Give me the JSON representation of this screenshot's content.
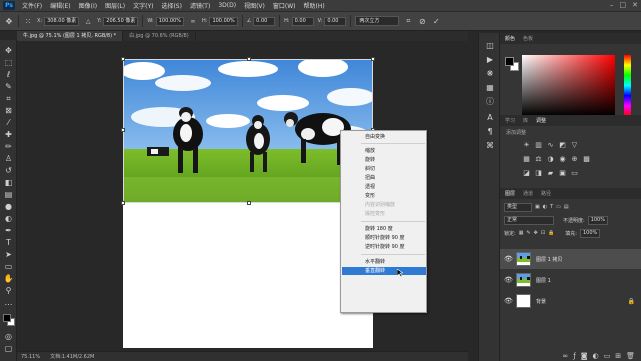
{
  "app": {
    "logo": "Ps",
    "menu": [
      "文件(F)",
      "编辑(E)",
      "图像(I)",
      "图层(L)",
      "文字(Y)",
      "选择(S)",
      "滤镜(T)",
      "3D(D)",
      "视图(V)",
      "窗口(W)",
      "帮助(H)"
    ]
  },
  "options": {
    "x_label": "X:",
    "x_value": "308.00 像素",
    "y_label": "Y:",
    "y_value": "206.50 像素",
    "w_label": "W:",
    "w_value": "100.00%",
    "h_label": "H:",
    "h_value": "100.00%",
    "angle_label": "∠",
    "angle_value": "0.00",
    "hskew_label": "H:",
    "hskew_value": "0.00",
    "vskew_label": "V:",
    "vskew_value": "0.00",
    "interp_value": "两次立方"
  },
  "tabs": [
    {
      "label": "牛.jpg @ 75.1% (图层 1 拷贝, RGB/8) *"
    },
    {
      "label": "白.jpg @ 70.6% (RGB/8)"
    }
  ],
  "context_menu": {
    "items": [
      {
        "label": "自由变换",
        "state": "normal"
      },
      {
        "label": "缩放",
        "state": "normal"
      },
      {
        "label": "旋转",
        "state": "normal"
      },
      {
        "label": "斜切",
        "state": "normal"
      },
      {
        "label": "扭曲",
        "state": "normal"
      },
      {
        "label": "透视",
        "state": "normal"
      },
      {
        "label": "变形",
        "state": "normal"
      },
      {
        "label": "内容识别缩放",
        "state": "disabled"
      },
      {
        "label": "操控变形",
        "state": "disabled"
      },
      {
        "label": "旋转 180 度",
        "state": "normal"
      },
      {
        "label": "顺时针旋转 90 度",
        "state": "normal"
      },
      {
        "label": "逆时针旋转 90 度",
        "state": "normal"
      },
      {
        "label": "水平翻转",
        "state": "normal"
      },
      {
        "label": "垂直翻转",
        "state": "selected"
      }
    ]
  },
  "status": {
    "zoom": "75.11%",
    "doc": "文档:1.41M/2.62M"
  },
  "panels": {
    "color_tabs": [
      "颜色",
      "色板"
    ],
    "adj_tabs": [
      "学习",
      "库",
      "调整"
    ],
    "adj_subtitle": "添加调整",
    "layer_tabs": [
      "图层",
      "通道",
      "路径"
    ],
    "kind_label": "类型",
    "blend_mode": "正常",
    "opacity_label": "不透明度:",
    "opacity_value": "100%",
    "lock_label": "锁定:",
    "fill_label": "填充:",
    "fill_value": "100%",
    "layers": [
      {
        "name": "图层 1 拷贝",
        "active": true
      },
      {
        "name": "图层 1",
        "active": false
      },
      {
        "name": "背景",
        "active": false
      }
    ]
  },
  "colors": {
    "accent": "#2f7ad3",
    "foreground": "#000000",
    "background": "#ffffff"
  }
}
